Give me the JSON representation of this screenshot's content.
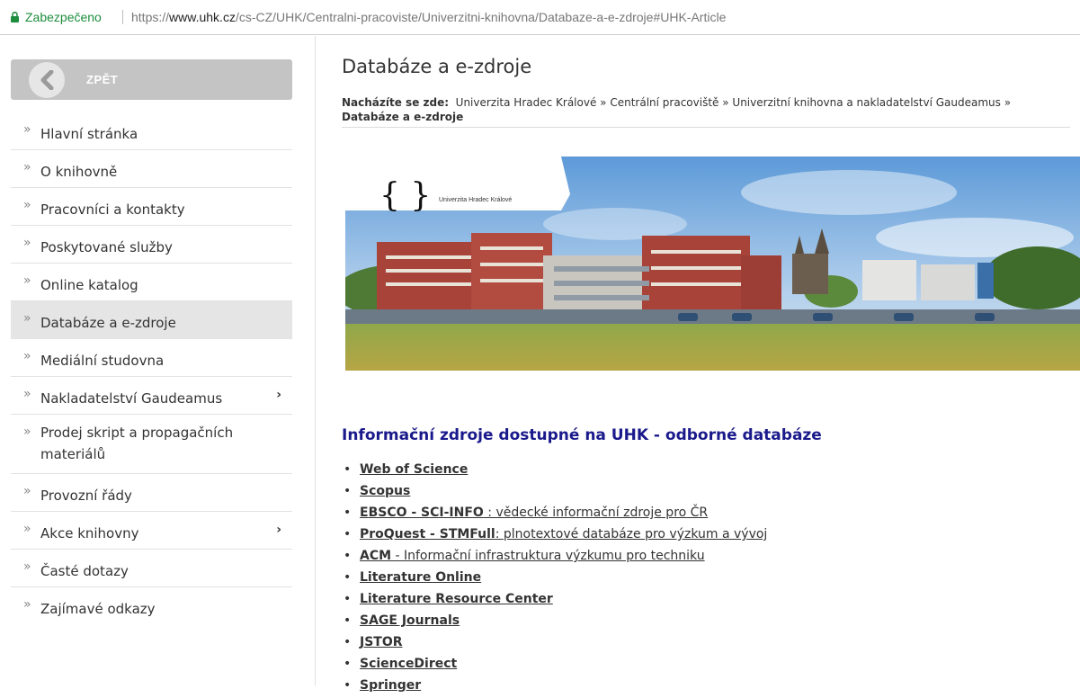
{
  "address_bar": {
    "secure_label": "Zabezpečeno",
    "url_scheme": "https://",
    "url_host": "www.uhk.cz",
    "url_path": "/cs-CZ/UHK/Centralni-pracoviste/Univerzitni-knihovna/Databaze-a-e-zdroje#UHK-Article"
  },
  "sidebar": {
    "back_label": "ZPĚT",
    "items": [
      {
        "label": "Hlavní stránka"
      },
      {
        "label": "O knihovně"
      },
      {
        "label": "Pracovníci a kontakty"
      },
      {
        "label": "Poskytované služby"
      },
      {
        "label": "Online katalog"
      },
      {
        "label": "Databáze a e-zdroje"
      },
      {
        "label": "Mediální studovna"
      },
      {
        "label": "Nakladatelství Gaudeamus",
        "arrow": "›"
      },
      {
        "label": "Prodej skript a propagačních materiálů"
      },
      {
        "label": "Provozní řády"
      },
      {
        "label": "Akce knihovny",
        "arrow": "›"
      },
      {
        "label": "Časté dotazy"
      },
      {
        "label": "Zajímavé odkazy"
      }
    ]
  },
  "main": {
    "title": "Databáze a e-zdroje",
    "breadcrumb": {
      "label": "Nacházíte se zde:",
      "crumbs": [
        "Univerzita Hradec Králové",
        "Centrální pracoviště",
        "Univerzitní knihovna a nakladatelství Gaudeamus"
      ],
      "separator": "»",
      "current": "Databáze a e-zdroje"
    },
    "banner_logo_text": "Univerzita Hradec Králové",
    "section_heading": "Informační zdroje dostupné na UHK - odborné databáze",
    "databases": [
      {
        "name": "Web of Science",
        "desc": ""
      },
      {
        "name": "Scopus",
        "desc": ""
      },
      {
        "name": "EBSCO - SCI-INFO",
        "desc": " : vědecké informační zdroje pro ČR"
      },
      {
        "name": "ProQuest - STMFull",
        "desc": ": plnotextové databáze pro výzkum a vývoj"
      },
      {
        "name": "ACM",
        "desc": " - Informační infrastruktura výzkumu pro techniku"
      },
      {
        "name": "Literature Online",
        "desc": ""
      },
      {
        "name": "Literature Resource Center",
        "desc": ""
      },
      {
        "name": "SAGE Journals",
        "desc": ""
      },
      {
        "name": "JSTOR",
        "desc": ""
      },
      {
        "name": "ScienceDirect",
        "desc": ""
      },
      {
        "name": "Springer",
        "desc": ""
      }
    ]
  },
  "colors": {
    "secure_green": "#1e8e3e",
    "heading_blue": "#1a1a8c",
    "active_item_bg": "#e5e5e5"
  }
}
